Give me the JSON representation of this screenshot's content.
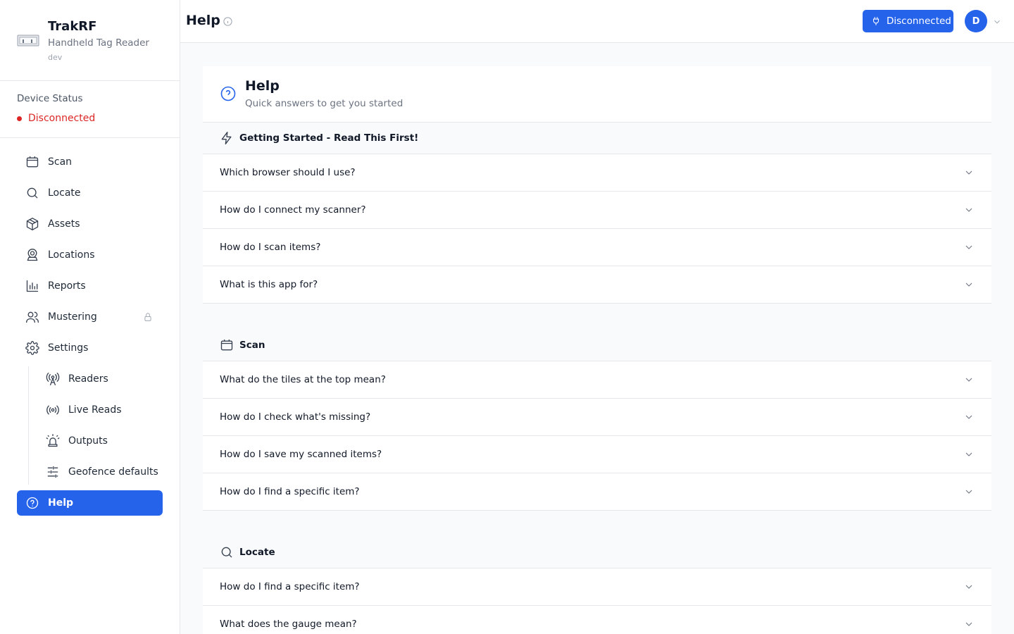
{
  "app": {
    "name": "TrakRF",
    "subtitle": "Handheld Tag Reader",
    "env": "dev"
  },
  "device_status": {
    "label": "Device Status",
    "value": "Disconnected",
    "color": "#dc2626"
  },
  "nav": {
    "items": [
      {
        "label": "Scan",
        "icon": "scan-icon"
      },
      {
        "label": "Locate",
        "icon": "search-icon"
      },
      {
        "label": "Assets",
        "icon": "box-icon"
      },
      {
        "label": "Locations",
        "icon": "map-pin-icon"
      },
      {
        "label": "Reports",
        "icon": "bar-chart-icon"
      },
      {
        "label": "Mustering",
        "icon": "users-icon",
        "locked": true
      },
      {
        "label": "Settings",
        "icon": "gear-icon"
      }
    ],
    "sub_items": [
      {
        "label": "Readers",
        "icon": "antenna-icon"
      },
      {
        "label": "Live Reads",
        "icon": "broadcast-icon"
      },
      {
        "label": "Outputs",
        "icon": "siren-icon"
      },
      {
        "label": "Geofence defaults",
        "icon": "sliders-icon"
      }
    ],
    "active": {
      "label": "Help",
      "icon": "help-circle-icon"
    }
  },
  "header": {
    "title": "Help",
    "connection_button": "Disconnected",
    "avatar_initial": "D",
    "accent": "#2563eb"
  },
  "help": {
    "title": "Help",
    "subtitle": "Quick answers to get you started",
    "sections": [
      {
        "title": "Getting Started - Read This First!",
        "icon": "zap-icon",
        "questions": [
          "Which browser should I use?",
          "How do I connect my scanner?",
          "How do I scan items?",
          "What is this app for?"
        ]
      },
      {
        "title": "Scan",
        "icon": "scan-icon",
        "questions": [
          "What do the tiles at the top mean?",
          "How do I check what's missing?",
          "How do I save my scanned items?",
          "How do I find a specific item?"
        ]
      },
      {
        "title": "Locate",
        "icon": "search-icon",
        "questions": [
          "How do I find a specific item?",
          "What does the gauge mean?"
        ]
      }
    ]
  }
}
